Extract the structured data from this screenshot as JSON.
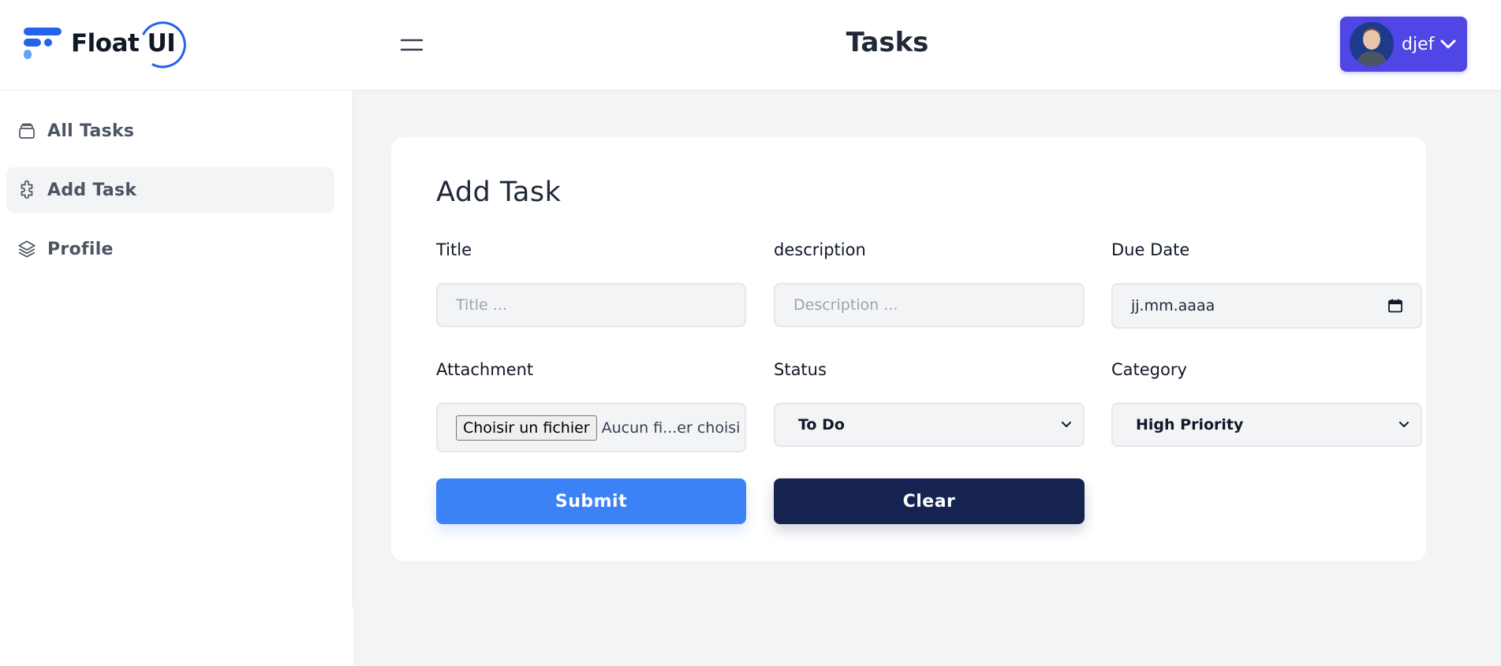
{
  "header": {
    "logo_text": "Float UI",
    "page_title": "Tasks",
    "user_name": "djef"
  },
  "sidebar": {
    "items": [
      {
        "label": "All Tasks",
        "icon": "archive-icon"
      },
      {
        "label": "Add Task",
        "icon": "puzzle-icon"
      },
      {
        "label": "Profile",
        "icon": "layers-icon"
      }
    ],
    "active_index": 1
  },
  "form": {
    "title": "Add Task",
    "title_field": {
      "label": "Title",
      "placeholder": "Title ..."
    },
    "description_field": {
      "label": "description",
      "placeholder": "Description ..."
    },
    "due_date_field": {
      "label": "Due Date",
      "placeholder": "jj.mm.aaaa"
    },
    "attachment_field": {
      "label": "Attachment",
      "button": "Choisir un fichier",
      "status": "Aucun fi...er choisi"
    },
    "status_field": {
      "label": "Status",
      "value": "To Do"
    },
    "category_field": {
      "label": "Category",
      "value": "High Priority"
    },
    "submit_label": "Submit",
    "clear_label": "Clear"
  },
  "colors": {
    "accent": "#4f46e5",
    "submit": "#3b82f6",
    "clear": "#162350",
    "logo": "#2563eb"
  }
}
